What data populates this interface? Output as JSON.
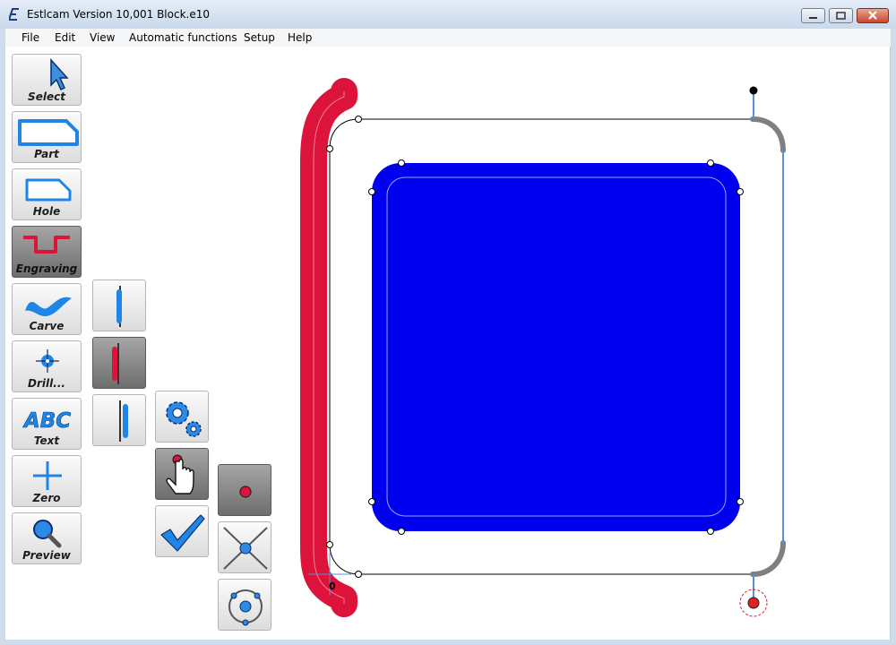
{
  "window": {
    "title": "Estlcam Version 10,001 Block.e10"
  },
  "menu": {
    "items": [
      "File",
      "Edit",
      "View",
      "Automatic functions",
      "Setup",
      "Help"
    ]
  },
  "toolbar": {
    "tools": [
      {
        "label": "Select",
        "icon": "arrow-cursor-icon",
        "active": false
      },
      {
        "label": "Part",
        "icon": "part-outline-icon",
        "active": false
      },
      {
        "label": "Hole",
        "icon": "hole-outline-icon",
        "active": false
      },
      {
        "label": "Engraving",
        "icon": "engraving-path-icon",
        "active": true
      },
      {
        "label": "Carve",
        "icon": "carve-wave-icon",
        "active": false
      },
      {
        "label": "Drill...",
        "icon": "drill-crosshair-icon",
        "active": false
      },
      {
        "label": "Text",
        "icon": "abc-text-icon",
        "active": false
      },
      {
        "label": "Zero",
        "icon": "zero-cross-icon",
        "active": false
      },
      {
        "label": "Preview",
        "icon": "magnifier-icon",
        "active": false
      }
    ]
  },
  "engraving_options": {
    "side_buttons": [
      {
        "icon": "path-left-icon",
        "active": false
      },
      {
        "icon": "path-center-icon",
        "active": true
      },
      {
        "icon": "path-right-icon",
        "active": false
      }
    ],
    "action_buttons": [
      {
        "icon": "gears-icon",
        "active": false
      },
      {
        "icon": "hand-pointer-icon",
        "active": true
      },
      {
        "icon": "checkmark-icon",
        "active": false
      }
    ],
    "start_buttons": [
      {
        "icon": "start-point-dot-icon",
        "active": true
      },
      {
        "icon": "start-point-intersection-icon",
        "active": false
      },
      {
        "icon": "start-point-circle-icon",
        "active": false
      }
    ]
  },
  "drawing": {
    "origin_label": "0",
    "colors": {
      "engraving_path": "#dc143c",
      "pocket_fill": "#0000ee",
      "tool_path": "#5b8fd6",
      "lead_in": "#808080",
      "start_point": "#e02020"
    }
  }
}
